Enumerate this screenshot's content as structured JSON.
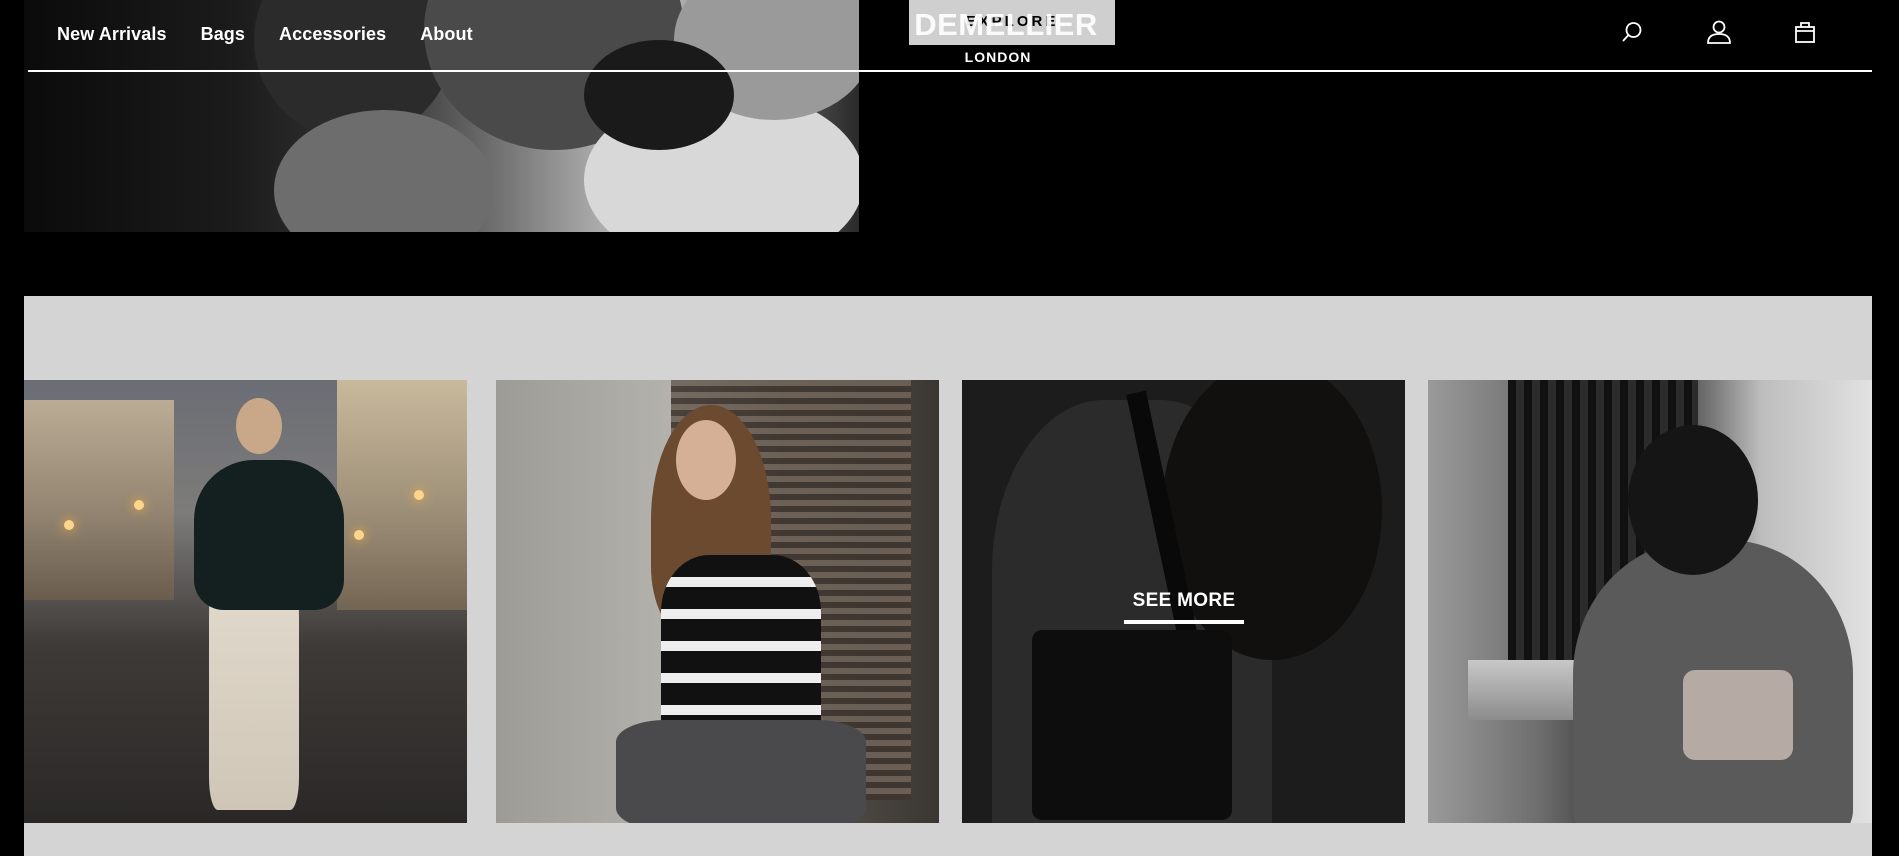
{
  "header": {
    "nav": [
      {
        "label": "New Arrivals"
      },
      {
        "label": "Bags"
      },
      {
        "label": "Accessories"
      },
      {
        "label": "About"
      }
    ],
    "explore_label": "EXPLORE",
    "logo": {
      "name": "DEMELLIER",
      "city": "LONDON"
    },
    "icons": {
      "search": "search-icon",
      "account": "user-icon",
      "cart": "shopping-bag-icon"
    }
  },
  "gallery": {
    "see_more_label": "SEE MORE",
    "background": "#d4d4d4"
  },
  "colors": {
    "page_background": "#000000",
    "header_text": "#ffffff",
    "explore_background": "#cfcfcf"
  }
}
